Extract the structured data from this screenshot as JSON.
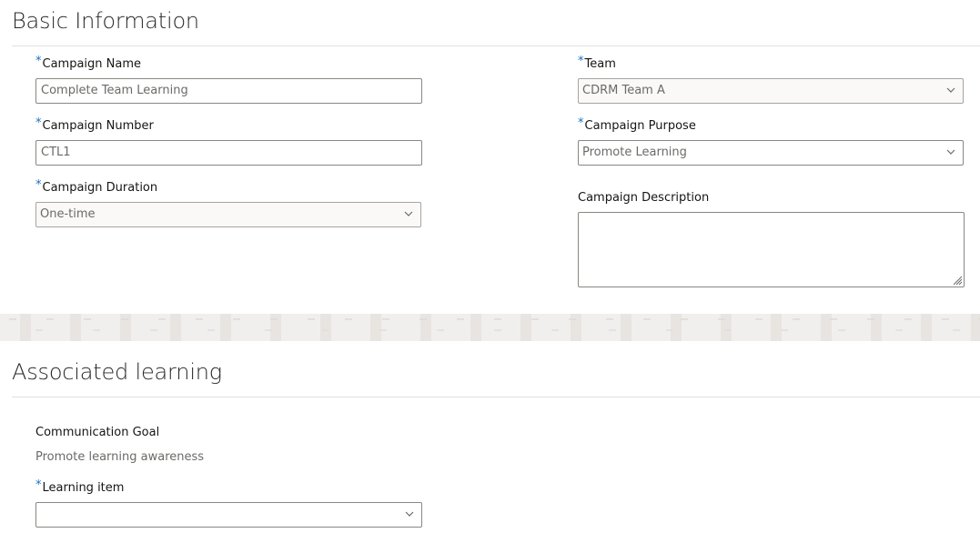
{
  "basic_info": {
    "title": "Basic Information",
    "required_marker": "*",
    "campaign_name": {
      "label": "Campaign Name",
      "value": "Complete Team Learning"
    },
    "campaign_number": {
      "label": "Campaign Number",
      "value": "CTL1"
    },
    "campaign_duration": {
      "label": "Campaign Duration",
      "value": "One-time"
    },
    "team": {
      "label": "Team",
      "value": "CDRM Team A"
    },
    "campaign_purpose": {
      "label": "Campaign Purpose",
      "value": "Promote Learning"
    },
    "campaign_description": {
      "label": "Campaign Description",
      "value": ""
    }
  },
  "associated_learning": {
    "title": "Associated learning",
    "communication_goal": {
      "label": "Communication Goal",
      "value": "Promote learning awareness"
    },
    "learning_item": {
      "label": "Learning item",
      "value": ""
    }
  },
  "icons": {
    "dropdown": "chevron-down-icon",
    "resize": "resize-grip-icon"
  },
  "colors": {
    "required_marker": "#1a6fbf",
    "field_border": "#8a8782",
    "separator_band": "#f1efed"
  }
}
